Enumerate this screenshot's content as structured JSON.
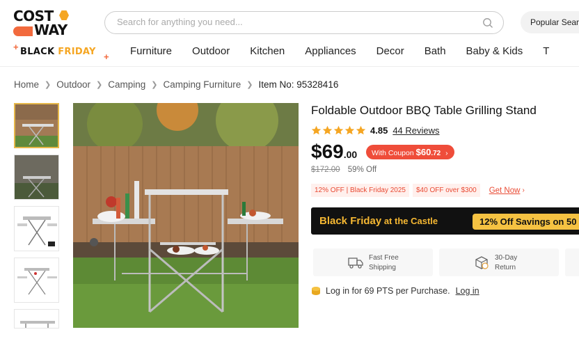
{
  "header": {
    "logo_top": "COST",
    "logo_bottom": "WAY",
    "search_placeholder": "Search for anything you need...",
    "popular_label": "Popular Sear",
    "black_friday_left": "BLACK ",
    "black_friday_right": "FRIDAY"
  },
  "nav": [
    "Furniture",
    "Outdoor",
    "Kitchen",
    "Appliances",
    "Decor",
    "Bath",
    "Baby & Kids",
    "T"
  ],
  "breadcrumb": [
    "Home",
    "Outdoor",
    "Camping",
    "Camping Furniture",
    "Item No: 95328416"
  ],
  "product": {
    "title": "Foldable Outdoor BBQ Table Grilling Stand",
    "rating": "4.85",
    "rating_stars": 5,
    "reviews": "44 Reviews",
    "price_dollar": "$69",
    "price_cents": ".00",
    "coupon_prefix": "With Coupon ",
    "coupon_price": "$60",
    "coupon_cents": ".72",
    "was_price": "$172.00",
    "discount": "59% Off",
    "promos": [
      "12% OFF | Black Friday 2025",
      "$40 OFF over $300"
    ],
    "get_now": "Get Now"
  },
  "banner": {
    "left_part1": "Black Friday",
    "left_part2": " at the Castle",
    "right": "12% Off Savings on 50"
  },
  "features": [
    {
      "line1": "Fast Free",
      "line2": "Shipping",
      "icon": "truck-icon"
    },
    {
      "line1": "30-Day",
      "line2": "Return",
      "icon": "return-box-icon"
    }
  ],
  "points": {
    "text": "Log in for 69 PTS per Purchase.",
    "login": "Log in"
  },
  "colors": {
    "accent": "#ef4d3a",
    "gold": "#f5b732",
    "star": "#f5a623"
  }
}
